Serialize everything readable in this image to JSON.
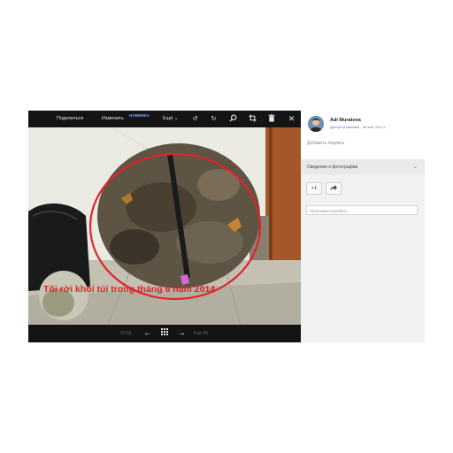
{
  "toolbar": {
    "share": "Поделиться",
    "edit": "Изменить",
    "new_badge": "НОВИНКА",
    "more": "Ещё",
    "icons": [
      "rotate-left-icon",
      "rotate-right-icon",
      "zoom-icon",
      "crop-icon",
      "trash-icon",
      "close-icon"
    ]
  },
  "photo": {
    "caption": "Tôi rời khỏi túi trong tháng 6 năm 2014"
  },
  "bottombar": {
    "time": "03:01",
    "counter": "5 из 90"
  },
  "sidebar": {
    "username": "Adi Muratova",
    "access": "Доступ ограничен",
    "date": "- 28 янв. 2014 г.",
    "add_caption": "Добавить подпись",
    "details_label": "Сведения о фотографии",
    "plus_one": "+1",
    "comment_placeholder": "Прокомментировать"
  },
  "colors": {
    "annotation": "#e0242a",
    "link": "#3a6fd6",
    "toolbar_bg": "#141414"
  }
}
